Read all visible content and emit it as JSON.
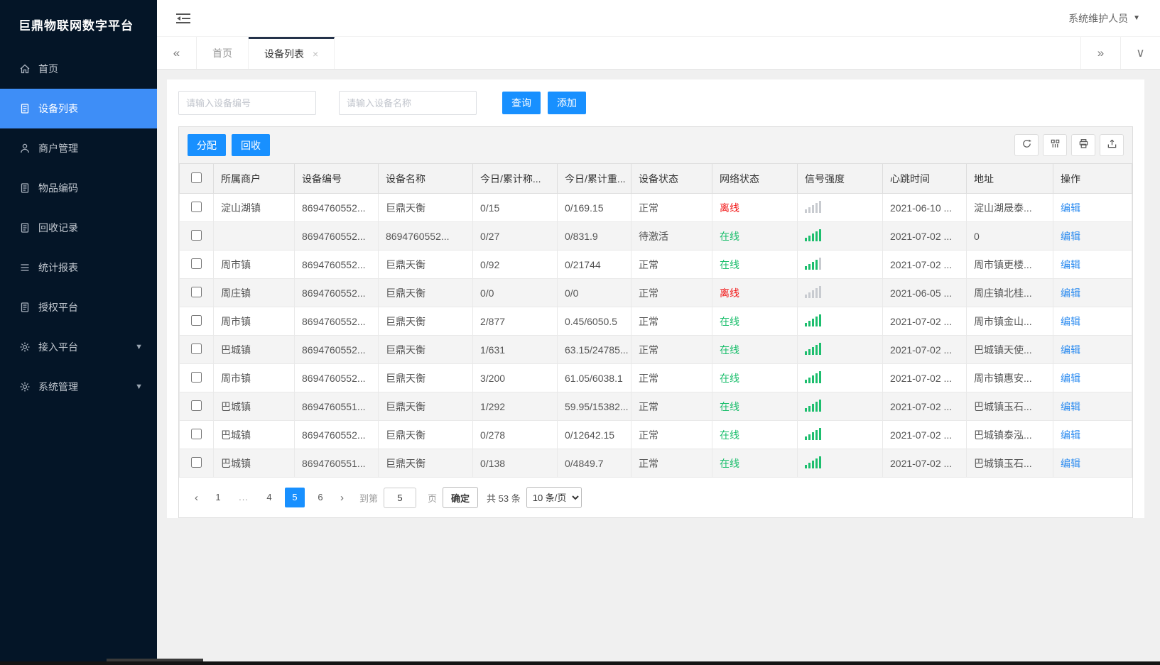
{
  "app": {
    "title": "巨鼎物联网数字平台",
    "user": "系统维护人员"
  },
  "sidebar": {
    "items": [
      {
        "label": "首页",
        "icon": "home",
        "active": false,
        "arrow": false
      },
      {
        "label": "设备列表",
        "icon": "doc",
        "active": true,
        "arrow": false
      },
      {
        "label": "商户管理",
        "icon": "user",
        "active": false,
        "arrow": false
      },
      {
        "label": "物品编码",
        "icon": "doc",
        "active": false,
        "arrow": false
      },
      {
        "label": "回收记录",
        "icon": "doc",
        "active": false,
        "arrow": false
      },
      {
        "label": "统计报表",
        "icon": "lines",
        "active": false,
        "arrow": false
      },
      {
        "label": "授权平台",
        "icon": "doc",
        "active": false,
        "arrow": false
      },
      {
        "label": "接入平台",
        "icon": "gear",
        "active": false,
        "arrow": true
      },
      {
        "label": "系统管理",
        "icon": "gear",
        "active": false,
        "arrow": true
      }
    ]
  },
  "tabs": {
    "home": "首页",
    "active": "设备列表"
  },
  "search": {
    "device_no_placeholder": "请输入设备编号",
    "device_name_placeholder": "请输入设备名称",
    "query_label": "查询",
    "add_label": "添加"
  },
  "toolbar": {
    "assign_label": "分配",
    "recycle_label": "回收",
    "icons": [
      "refresh",
      "columns",
      "print",
      "export"
    ]
  },
  "table": {
    "headers": [
      "所属商户",
      "设备编号",
      "设备名称",
      "今日/累计称...",
      "今日/累计重...",
      "设备状态",
      "网络状态",
      "信号强度",
      "心跳时间",
      "地址",
      "操作"
    ],
    "edit_label": "编辑",
    "rows": [
      {
        "merchant": "淀山湖镇",
        "device_no": "8694760552...",
        "device_name": "巨鼎天衡",
        "today_count": "0/15",
        "today_weight": "0/169.15",
        "device_status": "正常",
        "network": "离线",
        "online": false,
        "signal": 0,
        "heartbeat": "2021-06-10 ...",
        "address": "淀山湖晟泰..."
      },
      {
        "merchant": "",
        "device_no": "8694760552...",
        "device_name": "8694760552...",
        "today_count": "0/27",
        "today_weight": "0/831.9",
        "device_status": "待激活",
        "network": "在线",
        "online": true,
        "signal": 5,
        "heartbeat": "2021-07-02 ...",
        "address": "0"
      },
      {
        "merchant": "周市镇",
        "device_no": "8694760552...",
        "device_name": "巨鼎天衡",
        "today_count": "0/92",
        "today_weight": "0/21744",
        "device_status": "正常",
        "network": "在线",
        "online": true,
        "signal": 4,
        "heartbeat": "2021-07-02 ...",
        "address": "周市镇更楼..."
      },
      {
        "merchant": "周庄镇",
        "device_no": "8694760552...",
        "device_name": "巨鼎天衡",
        "today_count": "0/0",
        "today_weight": "0/0",
        "device_status": "正常",
        "network": "离线",
        "online": false,
        "signal": 0,
        "heartbeat": "2021-06-05 ...",
        "address": "周庄镇北桂..."
      },
      {
        "merchant": "周市镇",
        "device_no": "8694760552...",
        "device_name": "巨鼎天衡",
        "today_count": "2/877",
        "today_weight": "0.45/6050.5",
        "device_status": "正常",
        "network": "在线",
        "online": true,
        "signal": 5,
        "heartbeat": "2021-07-02 ...",
        "address": "周市镇金山..."
      },
      {
        "merchant": "巴城镇",
        "device_no": "8694760552...",
        "device_name": "巨鼎天衡",
        "today_count": "1/631",
        "today_weight": "63.15/24785...",
        "device_status": "正常",
        "network": "在线",
        "online": true,
        "signal": 5,
        "heartbeat": "2021-07-02 ...",
        "address": "巴城镇天使..."
      },
      {
        "merchant": "周市镇",
        "device_no": "8694760552...",
        "device_name": "巨鼎天衡",
        "today_count": "3/200",
        "today_weight": "61.05/6038.1",
        "device_status": "正常",
        "network": "在线",
        "online": true,
        "signal": 5,
        "heartbeat": "2021-07-02 ...",
        "address": "周市镇惠安..."
      },
      {
        "merchant": "巴城镇",
        "device_no": "8694760551...",
        "device_name": "巨鼎天衡",
        "today_count": "1/292",
        "today_weight": "59.95/15382...",
        "device_status": "正常",
        "network": "在线",
        "online": true,
        "signal": 5,
        "heartbeat": "2021-07-02 ...",
        "address": "巴城镇玉石..."
      },
      {
        "merchant": "巴城镇",
        "device_no": "8694760552...",
        "device_name": "巨鼎天衡",
        "today_count": "0/278",
        "today_weight": "0/12642.15",
        "device_status": "正常",
        "network": "在线",
        "online": true,
        "signal": 5,
        "heartbeat": "2021-07-02 ...",
        "address": "巴城镇泰泓..."
      },
      {
        "merchant": "巴城镇",
        "device_no": "8694760551...",
        "device_name": "巨鼎天衡",
        "today_count": "0/138",
        "today_weight": "0/4849.7",
        "device_status": "正常",
        "network": "在线",
        "online": true,
        "signal": 5,
        "heartbeat": "2021-07-02 ...",
        "address": "巴城镇玉石..."
      }
    ]
  },
  "pagination": {
    "pages": [
      "1",
      "...",
      "4",
      "5",
      "6"
    ],
    "active_page": "5",
    "goto_label": "到第",
    "goto_value": "5",
    "page_word": "页",
    "confirm_label": "确定",
    "total_label": "共 53 条",
    "page_size": "10 条/页"
  },
  "colors": {
    "sidebar_bg": "#041527",
    "active_item": "#3e8ef7",
    "primary_blue": "#1890ff",
    "online_green": "#19be6b",
    "offline_red": "#f21717",
    "link_blue": "#2d8cf0"
  }
}
